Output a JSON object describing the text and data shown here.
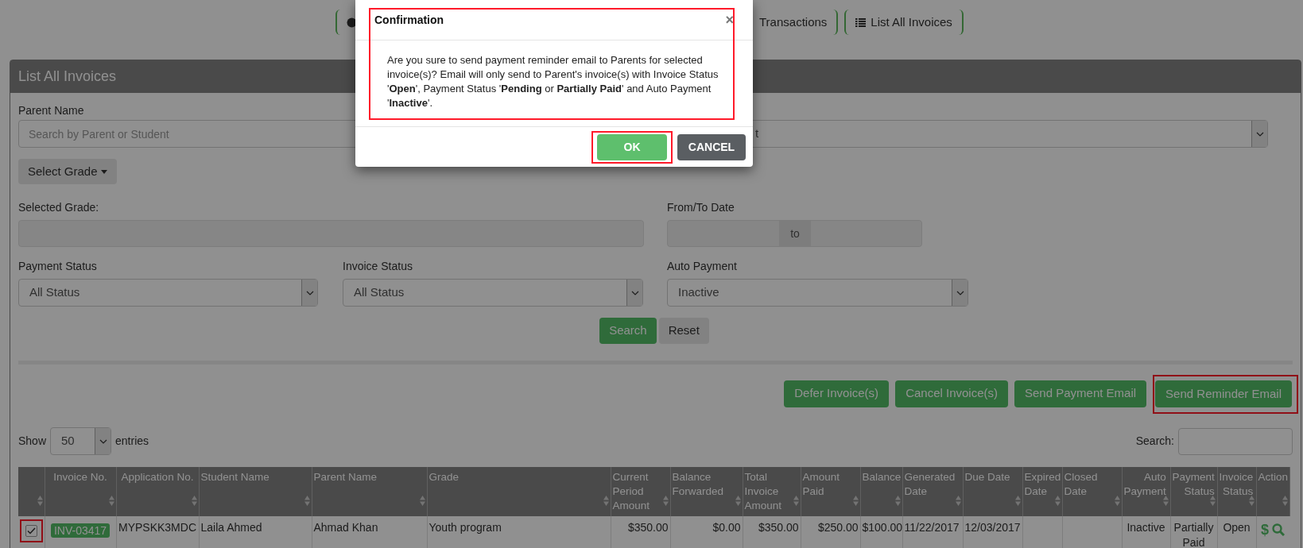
{
  "nav_tabs": [
    {
      "label": "Transactions"
    },
    {
      "label": "List All Invoices"
    }
  ],
  "panel": {
    "title": "List All Invoices"
  },
  "filters": {
    "parent_name_label": "Parent Name",
    "parent_name_placeholder": "Search by Parent or Student",
    "student_select_value": "t",
    "select_grade_button": "Select Grade",
    "selected_grade_label": "Selected Grade:",
    "date_label": "From/To Date",
    "date_separator": "to",
    "payment_status_label": "Payment Status",
    "payment_status_value": "All Status",
    "invoice_status_label": "Invoice Status",
    "invoice_status_value": "All Status",
    "auto_payment_label": "Auto Payment",
    "auto_payment_value": "Inactive",
    "search_button": "Search",
    "reset_button": "Reset"
  },
  "actions": [
    {
      "label": "Defer Invoice(s)",
      "highlighted": false
    },
    {
      "label": "Cancel Invoice(s)",
      "highlighted": false
    },
    {
      "label": "Send Payment Email",
      "highlighted": false
    },
    {
      "label": "Send Reminder Email",
      "highlighted": true
    }
  ],
  "table_controls": {
    "show_label": "Show",
    "page_size": "50",
    "entries_label": "entries",
    "search_label": "Search:"
  },
  "table": {
    "columns": [
      {
        "kind": "checkbox"
      },
      {
        "kind": "text",
        "label": "Invoice No."
      },
      {
        "kind": "text",
        "label": "Application No."
      },
      {
        "kind": "text",
        "label": "Student Name"
      },
      {
        "kind": "text",
        "label": "Parent Name"
      },
      {
        "kind": "text",
        "label": "Grade"
      },
      {
        "kind": "text",
        "label": "Current Period Amount"
      },
      {
        "kind": "text",
        "label": "Balance Forwarded"
      },
      {
        "kind": "text",
        "label": "Total Invoice Amount"
      },
      {
        "kind": "text",
        "label": "Amount Paid"
      },
      {
        "kind": "text",
        "label": "Balance"
      },
      {
        "kind": "text",
        "label": "Generated Date"
      },
      {
        "kind": "text",
        "label": "Due Date"
      },
      {
        "kind": "text",
        "label": "Expired Date"
      },
      {
        "kind": "text",
        "label": "Closed Date"
      },
      {
        "kind": "text",
        "label": "Auto Payment"
      },
      {
        "kind": "text",
        "label": "Payment Status"
      },
      {
        "kind": "text",
        "label": "Invoice Status"
      },
      {
        "kind": "text",
        "label": "Action"
      }
    ],
    "rows": [
      {
        "checked": true,
        "highlighted": true,
        "cells": [
          "",
          "INV-03417",
          "MYPSKK3MDC",
          "Laila Ahmed",
          "Ahmad Khan",
          "Youth program",
          "$350.00",
          "$0.00",
          "$350.00",
          "$250.00",
          "$100.00",
          "11/22/2017",
          "12/03/2017",
          "",
          "",
          "Inactive",
          "Partially Paid",
          "Open",
          "$"
        ]
      }
    ]
  },
  "modal": {
    "title": "Confirmation",
    "close": "×",
    "message": "Are you sure to send payment reminder email to Parents for selected invoice(s)? Email will only send to Parent's invoice(s) with Invoice Status '**Open**', Payment Status '**Pending** or **Partially Paid**' and Auto Payment '**Inactive**'.",
    "content_highlighted": true,
    "buttons": [
      {
        "label": "OK",
        "kind": "confirm",
        "highlighted": true
      },
      {
        "label": "CANCEL",
        "kind": "cancel",
        "highlighted": false
      }
    ]
  }
}
